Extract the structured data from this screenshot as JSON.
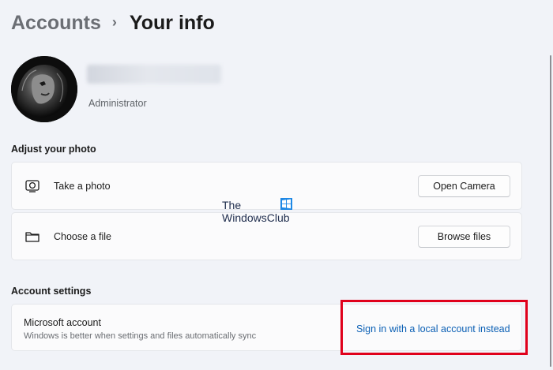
{
  "breadcrumb": {
    "parent": "Accounts",
    "separator": "›",
    "current": "Your info"
  },
  "profile": {
    "role": "Administrator"
  },
  "adjust_photo": {
    "title": "Adjust your photo",
    "items": [
      {
        "icon": "camera-icon",
        "label": "Take a photo",
        "button": "Open Camera"
      },
      {
        "icon": "folder-icon",
        "label": "Choose a file",
        "button": "Browse files"
      }
    ]
  },
  "account_settings": {
    "title": "Account settings",
    "microsoft_account": {
      "title": "Microsoft account",
      "description": "Windows is better when settings and files automatically sync",
      "link": "Sign in with a local account instead"
    }
  },
  "watermark": {
    "line1": "The",
    "line2": "WindowsClub"
  },
  "colors": {
    "background": "#f1f3f8",
    "card": "#fbfbfc",
    "link": "#0a5fb4",
    "highlight": "#e0001b"
  }
}
